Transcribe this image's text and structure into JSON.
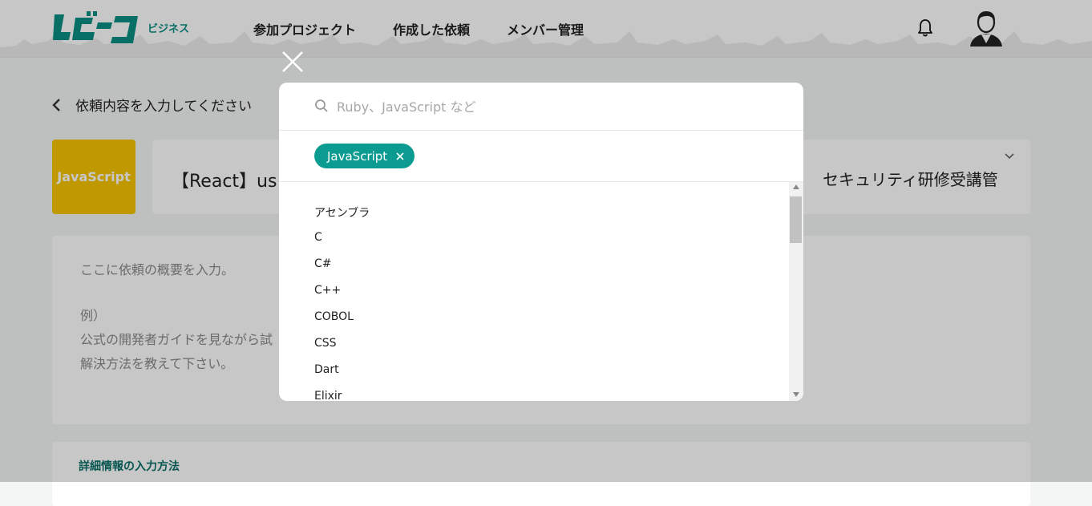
{
  "header": {
    "logo_sub": "ビジネス",
    "nav": [
      "参加プロジェクト",
      "作成した依頼",
      "メンバー管理"
    ]
  },
  "page": {
    "back_label": "依頼内容を入力してください",
    "language_tile": "JavaScript",
    "request_title": "【React】us",
    "request_right": "セキュリティ研修受講管",
    "description": [
      "ここに依頼の概要を入力。",
      "例）",
      "公式の開発者ガイドを見ながら試",
      "解決方法を教えて下さい。"
    ],
    "detail_title": "詳細情報の入力方法"
  },
  "modal": {
    "search_placeholder": "Ruby、JavaScript など",
    "selected_chip": "JavaScript",
    "options": [
      "アセンブラ",
      "C",
      "C#",
      "C++",
      "COBOL",
      "CSS",
      "Dart",
      "Elixir"
    ]
  },
  "colors": {
    "accent": "#0b9b90",
    "tile": "#f7c400",
    "overlay": "rgba(0,0,0,0.22)"
  }
}
